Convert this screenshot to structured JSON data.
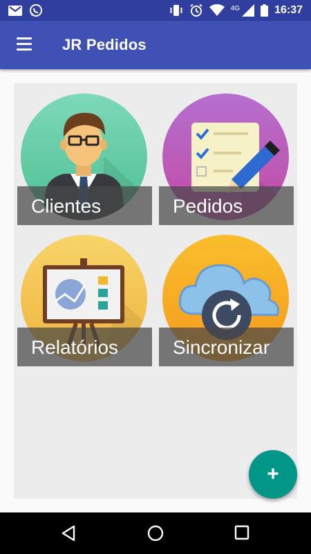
{
  "status_bar": {
    "time": "16:37",
    "network": "4G",
    "left_icons": [
      "gmail-icon",
      "whatsapp-icon"
    ],
    "right_icons": [
      "vibrate-icon",
      "alarm-icon",
      "wifi-icon",
      "signal-icon",
      "battery-icon"
    ]
  },
  "app_bar": {
    "title": "JR Pedidos",
    "menu_icon": "hamburger-menu-icon",
    "background": "#3f51b5"
  },
  "tiles": [
    {
      "label": "Clientes",
      "icon": "businessman-icon"
    },
    {
      "label": "Pedidos",
      "icon": "checklist-pencil-icon"
    },
    {
      "label": "Relatórios",
      "icon": "presentation-board-icon"
    },
    {
      "label": "Sincronizar",
      "icon": "cloud-sync-icon"
    }
  ],
  "fab": {
    "label": "+",
    "color": "#009688"
  },
  "nav_bar": [
    "back-icon",
    "home-icon",
    "recents-icon"
  ]
}
